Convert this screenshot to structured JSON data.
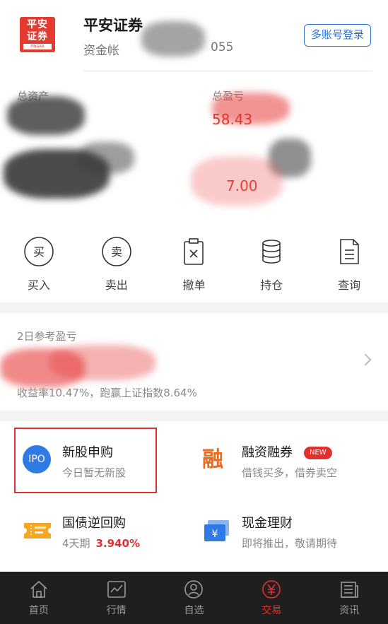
{
  "header": {
    "logo_line1": "平安",
    "logo_line2": "证券",
    "logo_sub": "PINGAN",
    "brand_name": "平安证券",
    "account_label": "资金帐",
    "account_number_suffix": "055",
    "multi_account_button": "多账号登录"
  },
  "assets": {
    "total_assets_label": "总资产",
    "total_profit_label": "总盈亏",
    "profit_value_partial": "58.43",
    "profit_value_partial_2": "7.00"
  },
  "actions": [
    {
      "label": "买入",
      "icon": "buy-icon",
      "glyph": "买"
    },
    {
      "label": "卖出",
      "icon": "sell-icon",
      "glyph": "卖"
    },
    {
      "label": "撤单",
      "icon": "cancel-order-icon"
    },
    {
      "label": "持仓",
      "icon": "holdings-icon"
    },
    {
      "label": "查询",
      "icon": "query-icon"
    }
  ],
  "profit_summary": {
    "title": "2日参考盈亏",
    "description": "收益率10.47%，跑赢上证指数8.64%"
  },
  "services": {
    "ipo": {
      "icon_text": "IPO",
      "title": "新股申购",
      "subtitle": "今日暂无新股"
    },
    "margin": {
      "icon_text": "融",
      "title": "融资融券",
      "badge": "NEW",
      "subtitle": "借钱买多，借券卖空"
    },
    "repo": {
      "title": "国债逆回购",
      "subtitle": "4天期",
      "rate": "3.940%"
    },
    "cash": {
      "icon_text": "¥",
      "title": "现金理财",
      "subtitle": "即将推出，敬请期待"
    }
  },
  "tabbar": [
    {
      "label": "首页",
      "icon": "home-icon",
      "active": false
    },
    {
      "label": "行情",
      "icon": "market-chart-icon",
      "active": false
    },
    {
      "label": "自选",
      "icon": "watchlist-icon",
      "active": false
    },
    {
      "label": "交易",
      "icon": "trade-yen-icon",
      "active": true
    },
    {
      "label": "资讯",
      "icon": "news-icon",
      "active": false
    }
  ],
  "colors": {
    "brand_red": "#e33b2f",
    "accent_blue": "#2a74d8",
    "tabbar_bg": "#1f1f1f",
    "highlight_red": "#e23030"
  }
}
